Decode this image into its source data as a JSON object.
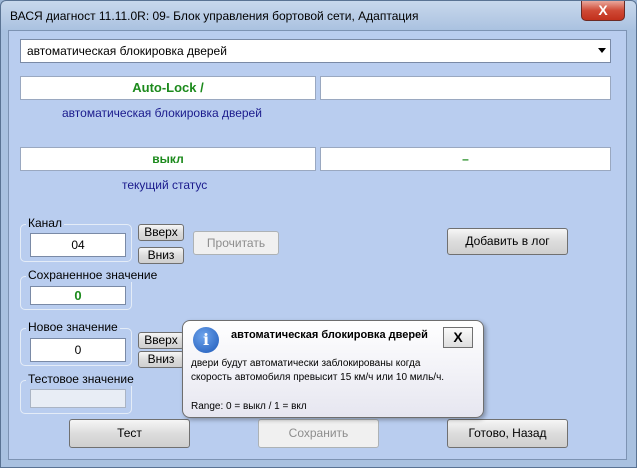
{
  "window": {
    "title": "ВАСЯ диагност 11.11.0R: 09- Блок управления бортовой сети, Адаптация",
    "close": "X"
  },
  "dropdown": {
    "selected": "автоматическая блокировка дверей"
  },
  "adaptation": {
    "name": "Auto-Lock /",
    "name_right": "",
    "description": "автоматическая блокировка дверей",
    "status_value": "выкл",
    "status_right": "–",
    "status_label": "текущий статус"
  },
  "channel": {
    "label": "Канал",
    "value": "04",
    "up": "Вверх",
    "down": "Вниз"
  },
  "read_button": "Прочитать",
  "log_button": "Добавить в лог",
  "saved": {
    "label": "Сохраненное значение",
    "value": "0"
  },
  "new_value": {
    "label": "Новое значение",
    "value": "0",
    "up": "Вверх",
    "down": "Вниз"
  },
  "test_value": {
    "label": "Тестовое значение",
    "value": ""
  },
  "buttons": {
    "test": "Тест",
    "save": "Сохранить",
    "done": "Готово, Назад"
  },
  "tooltip": {
    "title": "автоматическая блокировка дверей",
    "close": "X",
    "line1": "двери будут автоматически заблокированы когда",
    "line2": "скорость автомобиля превысит 15 км/ч или 10 миль/ч.",
    "range": "Range: 0 = выкл / 1 = вкл",
    "icon": "i"
  }
}
